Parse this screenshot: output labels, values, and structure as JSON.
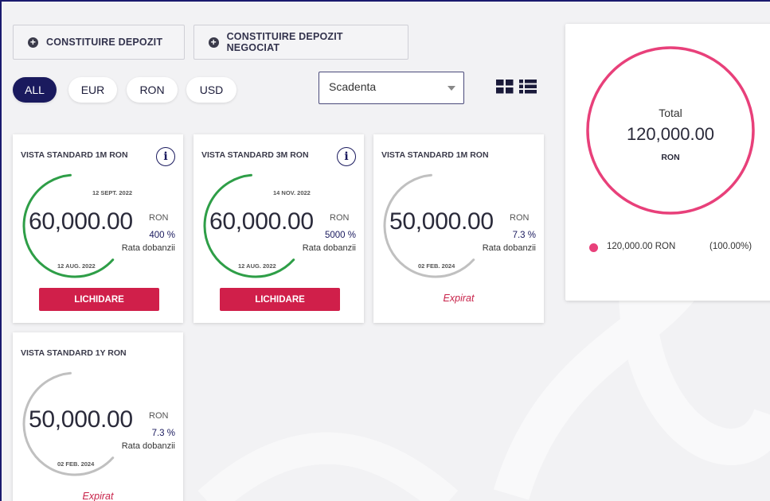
{
  "actions": {
    "create_deposit": "CONSTITUIRE DEPOZIT",
    "create_negotiated_deposit": "CONSTITUIRE DEPOZIT NEGOCIAT"
  },
  "currency_filters": [
    "ALL",
    "EUR",
    "RON",
    "USD"
  ],
  "active_filter": "ALL",
  "sort": {
    "selected": "Scadenta"
  },
  "deposits": [
    {
      "title": "VISTA STANDARD 1M RON",
      "start_date": "12 AUG. 2022",
      "maturity_date": "12 SEPT. 2022",
      "amount": "60,000.00",
      "currency": "RON",
      "rate": "400 %",
      "rate_label": "Rata dobanzii",
      "action": "LICHIDARE",
      "status": "active",
      "progress": 0.62,
      "arc_color": "#2e9e47"
    },
    {
      "title": "VISTA STANDARD 3M RON",
      "start_date": "12 AUG. 2022",
      "maturity_date": "14 NOV. 2022",
      "amount": "60,000.00",
      "currency": "RON",
      "rate": "5000 %",
      "rate_label": "Rata dobanzii",
      "action": "LICHIDARE",
      "status": "active",
      "progress": 0.62,
      "arc_color": "#2e9e47"
    },
    {
      "title": "VISTA STANDARD 1M RON",
      "start_date": "02 FEB. 2024",
      "amount": "50,000.00",
      "currency": "RON",
      "rate": "7.3 %",
      "rate_label": "Rata dobanzii",
      "status_label": "Expirat",
      "status": "expired",
      "progress": 0.62,
      "arc_color": "#c0c0c0"
    },
    {
      "title": "VISTA STANDARD 1Y RON",
      "start_date": "02 FEB. 2024",
      "amount": "50,000.00",
      "currency": "RON",
      "rate": "7.3 %",
      "rate_label": "Rata dobanzii",
      "status_label": "Expirat",
      "status": "expired",
      "progress": 0.62,
      "arc_color": "#c0c0c0"
    }
  ],
  "summary": {
    "label": "Total",
    "value": "120,000.00",
    "currency": "RON",
    "ring_color": "#e8407a",
    "legend": [
      {
        "amount": "120,000.00 RON",
        "percent": "(100.00%)",
        "color": "#e8407a"
      }
    ]
  },
  "colors": {
    "brand_navy": "#1a1a5e",
    "danger_red": "#d01f4a",
    "active_green": "#2e9e47"
  },
  "icons": [
    "plus-circle-icon",
    "grid-view-icon",
    "list-view-icon",
    "info-icon",
    "chevron-down-icon"
  ]
}
